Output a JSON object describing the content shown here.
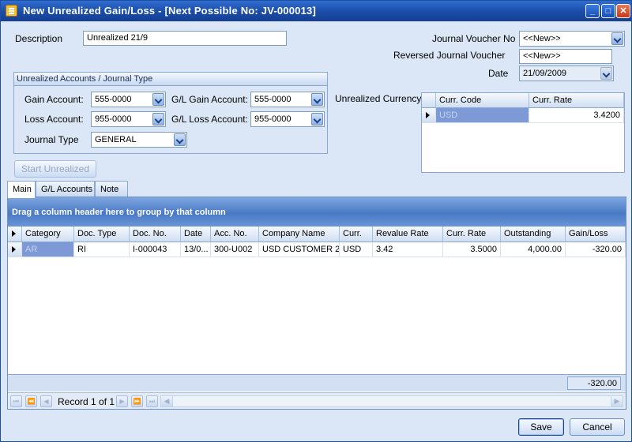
{
  "window": {
    "title": "New Unrealized Gain/Loss  - [Next Possible No: JV-000013]",
    "minimize": "_",
    "maximize": "□",
    "close": "✕"
  },
  "form": {
    "description_label": "Description",
    "description_value": "Unrealized 21/9",
    "jv_no_label": "Journal Voucher No",
    "jv_no_value": "<<New>>",
    "reversed_jv_label": "Reversed Journal Voucher",
    "reversed_jv_value": "<<New>>",
    "date_label": "Date",
    "date_value": "21/09/2009"
  },
  "accounts": {
    "group_title": "Unrealized Accounts / Journal Type",
    "gain_label": "Gain Account:",
    "gain_value": "555-0000",
    "gl_gain_label": "G/L Gain Account:",
    "gl_gain_value": "555-0000",
    "loss_label": "Loss Account:",
    "loss_value": "955-0000",
    "gl_loss_label": "G/L Loss Account:",
    "gl_loss_value": "955-0000",
    "journal_type_label": "Journal Type",
    "journal_type_value": "GENERAL"
  },
  "currency": {
    "label": "Unrealized Currency:",
    "columns": [
      "Curr. Code",
      "Curr. Rate"
    ],
    "rows": [
      {
        "code": "USD",
        "rate": "3.4200"
      }
    ]
  },
  "start_button": "Start Unrealized",
  "tabs": [
    "Main",
    "G/L Accounts",
    "Note"
  ],
  "grid": {
    "group_hint": "Drag a column header here to group by that column",
    "columns": [
      "Category",
      "Doc. Type",
      "Doc. No.",
      "Date",
      "Acc. No.",
      "Company Name",
      "Curr.",
      "Revalue Rate",
      "Curr. Rate",
      "Outstanding",
      "Gain/Loss"
    ],
    "rows": [
      [
        "AR",
        "RI",
        "I-000043",
        "13/0...",
        "300-U002",
        "USD CUSTOMER 2",
        "USD",
        "3.42",
        "3.5000",
        "4,000.00",
        "-320.00"
      ]
    ],
    "total": "-320.00",
    "record_text": "Record 1 of 1"
  },
  "buttons": {
    "save": "Save",
    "cancel": "Cancel"
  }
}
